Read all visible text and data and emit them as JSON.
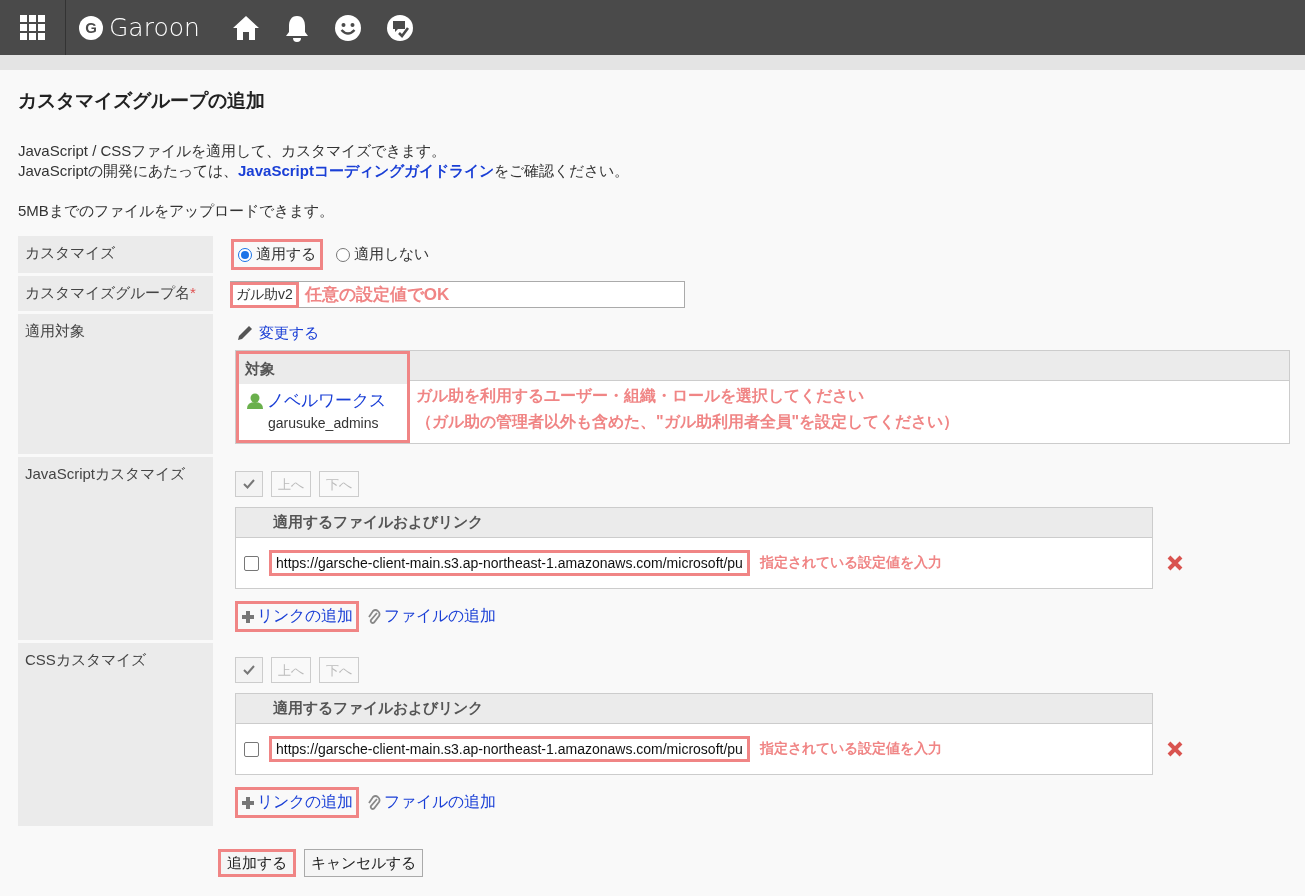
{
  "header": {
    "logo_letter": "G",
    "app_name": "Garoon"
  },
  "page_title": "カスタマイズグループの追加",
  "intro": {
    "line1": "JavaScript / CSSファイルを適用して、カスタマイズできます。",
    "line2_before": "JavaScriptの開発にあたっては、",
    "line2_link": "JavaScriptコーディングガイドライン",
    "line2_after": "をご確認ください。"
  },
  "upload_note": "5MBまでのファイルをアップロードできます。",
  "customize": {
    "label": "カスタマイズ",
    "options": [
      {
        "label": "適用する",
        "selected": true,
        "highlighted": true
      },
      {
        "label": "適用しない",
        "selected": false,
        "highlighted": false
      }
    ]
  },
  "group_name": {
    "label": "カスタマイズグループ名",
    "required_mark": "*",
    "value": "ガル助v2",
    "highlighted": true,
    "annotation": "任意の設定値でOK"
  },
  "target": {
    "label": "適用対象",
    "change_link": "変更する",
    "column": "対象",
    "highlighted": true,
    "entries": [
      {
        "name": "ノベルワークス",
        "code": "garusuke_admins"
      }
    ],
    "annotations": [
      "ガル助を利用するユーザー・組織・ロールを選択してください",
      "（ガル助の管理者以外も含めた、\"ガル助利用者全員\"を設定してください）"
    ]
  },
  "customizations": [
    {
      "label": "JavaScriptカスタマイズ",
      "buttons": [
        {
          "label": "上へ",
          "disabled": true
        },
        {
          "label": "下へ",
          "disabled": true
        }
      ],
      "column": "適用するファイルおよびリンク",
      "files": [
        {
          "checked": false,
          "value": "https://garsche-client-main.s3.ap-northeast-1.amazonaws.com/microsoft/pu",
          "highlighted": true,
          "annotation": "指定されている設定値を入力"
        }
      ],
      "add_link": {
        "label": "リンクの追加",
        "highlighted": true
      },
      "add_file": "ファイルの追加"
    },
    {
      "label": "CSSカスタマイズ",
      "buttons": [
        {
          "label": "上へ",
          "disabled": true
        },
        {
          "label": "下へ",
          "disabled": true
        }
      ],
      "column": "適用するファイルおよびリンク",
      "files": [
        {
          "checked": false,
          "value": "https://garsche-client-main.s3.ap-northeast-1.amazonaws.com/microsoft/pu",
          "highlighted": true,
          "annotation": "指定されている設定値を入力"
        }
      ],
      "add_link": {
        "label": "リンクの追加",
        "highlighted": true
      },
      "add_file": "ファイルの追加"
    }
  ],
  "actions": [
    {
      "label": "追加する",
      "highlighted": true
    },
    {
      "label": "キャンセルする",
      "highlighted": false
    }
  ]
}
